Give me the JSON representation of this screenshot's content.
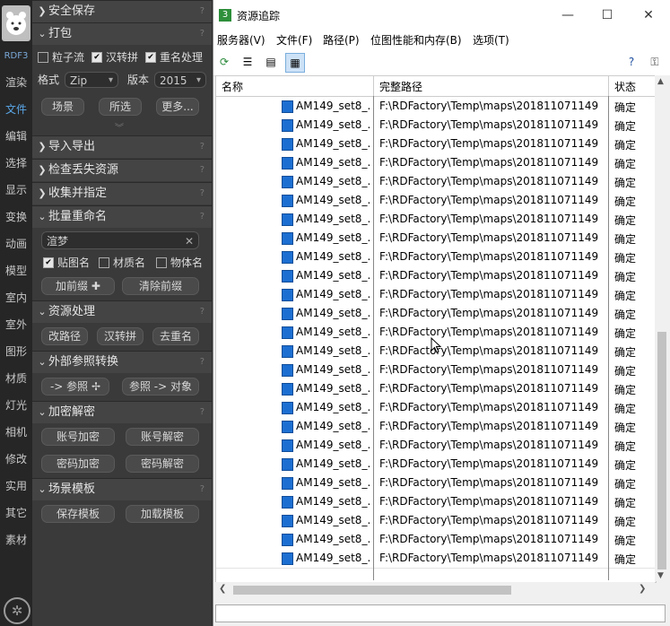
{
  "left_tabs": {
    "brand": "RDF3",
    "items": [
      "渲染",
      "文件",
      "编辑",
      "选择",
      "显示",
      "变换",
      "动画",
      "模型",
      "室内",
      "室外",
      "图形",
      "材质",
      "灯光",
      "相机",
      "修改",
      "实用",
      "其它",
      "素材"
    ],
    "active": "文件"
  },
  "panel": {
    "safe_save": "安全保存",
    "pack": {
      "title": "打包",
      "cb_particle": "粒子流",
      "cb_pinyin": "汉转拼",
      "cb_rename": "重名处理",
      "format_label": "格式",
      "format_value": "Zip",
      "version_label": "版本",
      "version_value": "2015",
      "btn_scene": "场景",
      "btn_selected": "所选",
      "btn_more": "更多..."
    },
    "import_export": "导入导出",
    "check_missing": "检查丢失资源",
    "collect": "收集并指定",
    "batch_rename": {
      "title": "批量重命名",
      "input_value": "渲梦",
      "cb_map": "贴图名",
      "cb_material": "材质名",
      "cb_object": "物体名",
      "btn_add_prefix": "加前缀",
      "btn_clear_prefix": "清除前缀"
    },
    "resource": {
      "title": "资源处理",
      "btn_path": "改路径",
      "btn_pinyin": "汉转拼",
      "btn_dedupe": "去重名"
    },
    "xref": {
      "title": "外部参照转换",
      "btn_to_ref": "-> 参照",
      "btn_ref_to_obj": "参照 -> 对象"
    },
    "crypto": {
      "title": "加密解密",
      "btn_acc_enc": "账号加密",
      "btn_acc_dec": "账号解密",
      "btn_pwd_enc": "密码加密",
      "btn_pwd_dec": "密码解密"
    },
    "template": {
      "title": "场景模板",
      "btn_save": "保存模板",
      "btn_load": "加载模板"
    }
  },
  "window": {
    "title": "资源追踪",
    "menus": [
      "服务器(V)",
      "文件(F)",
      "路径(P)",
      "位图性能和内存(B)",
      "选项(T)"
    ],
    "columns": {
      "name": "名称",
      "path": "完整路径",
      "status": "状态"
    },
    "rows": [
      {
        "name": "AM149_set8_...",
        "path": "F:\\RDFactory\\Temp\\maps\\201811071149",
        "status": "确定"
      },
      {
        "name": "AM149_set8_...",
        "path": "F:\\RDFactory\\Temp\\maps\\201811071149",
        "status": "确定"
      },
      {
        "name": "AM149_set8_...",
        "path": "F:\\RDFactory\\Temp\\maps\\201811071149",
        "status": "确定"
      },
      {
        "name": "AM149_set8_...",
        "path": "F:\\RDFactory\\Temp\\maps\\201811071149",
        "status": "确定"
      },
      {
        "name": "AM149_set8_...",
        "path": "F:\\RDFactory\\Temp\\maps\\201811071149",
        "status": "确定"
      },
      {
        "name": "AM149_set8_...",
        "path": "F:\\RDFactory\\Temp\\maps\\201811071149",
        "status": "确定"
      },
      {
        "name": "AM149_set8_...",
        "path": "F:\\RDFactory\\Temp\\maps\\201811071149",
        "status": "确定"
      },
      {
        "name": "AM149_set8_...",
        "path": "F:\\RDFactory\\Temp\\maps\\201811071149",
        "status": "确定"
      },
      {
        "name": "AM149_set8_...",
        "path": "F:\\RDFactory\\Temp\\maps\\201811071149",
        "status": "确定"
      },
      {
        "name": "AM149_set8_...",
        "path": "F:\\RDFactory\\Temp\\maps\\201811071149",
        "status": "确定"
      },
      {
        "name": "AM149_set8_...",
        "path": "F:\\RDFactory\\Temp\\maps\\201811071149",
        "status": "确定"
      },
      {
        "name": "AM149_set8_...",
        "path": "F:\\RDFactory\\Temp\\maps\\201811071149",
        "status": "确定"
      },
      {
        "name": "AM149_set8_...",
        "path": "F:\\RDFactory\\Temp\\maps\\201811071149",
        "status": "确定"
      },
      {
        "name": "AM149_set8_...",
        "path": "F:\\RDFactory\\Temp\\maps\\201811071149",
        "status": "确定"
      },
      {
        "name": "AM149_set8_...",
        "path": "F:\\RDFactory\\Temp\\maps\\201811071149",
        "status": "确定"
      },
      {
        "name": "AM149_set8_...",
        "path": "F:\\RDFactory\\Temp\\maps\\201811071149",
        "status": "确定"
      },
      {
        "name": "AM149_set8_...",
        "path": "F:\\RDFactory\\Temp\\maps\\201811071149",
        "status": "确定"
      },
      {
        "name": "AM149_set8_...",
        "path": "F:\\RDFactory\\Temp\\maps\\201811071149",
        "status": "确定"
      },
      {
        "name": "AM149_set8_...",
        "path": "F:\\RDFactory\\Temp\\maps\\201811071149",
        "status": "确定"
      },
      {
        "name": "AM149_set8_...",
        "path": "F:\\RDFactory\\Temp\\maps\\201811071149",
        "status": "确定"
      },
      {
        "name": "AM149_set8_...",
        "path": "F:\\RDFactory\\Temp\\maps\\201811071149",
        "status": "确定"
      },
      {
        "name": "AM149_set8_...",
        "path": "F:\\RDFactory\\Temp\\maps\\201811071149",
        "status": "确定"
      },
      {
        "name": "AM149_set8_...",
        "path": "F:\\RDFactory\\Temp\\maps\\201811071149",
        "status": "确定"
      },
      {
        "name": "AM149_set8_...",
        "path": "F:\\RDFactory\\Temp\\maps\\201811071149",
        "status": "确定"
      },
      {
        "name": "AM149_set8_...",
        "path": "F:\\RDFactory\\Temp\\maps\\201811071149",
        "status": "确定"
      }
    ]
  },
  "colors": {
    "accent_tab": "#5aa7e8",
    "panel_bg": "#3a3a3a",
    "file_icon": "#1c6fd1"
  }
}
